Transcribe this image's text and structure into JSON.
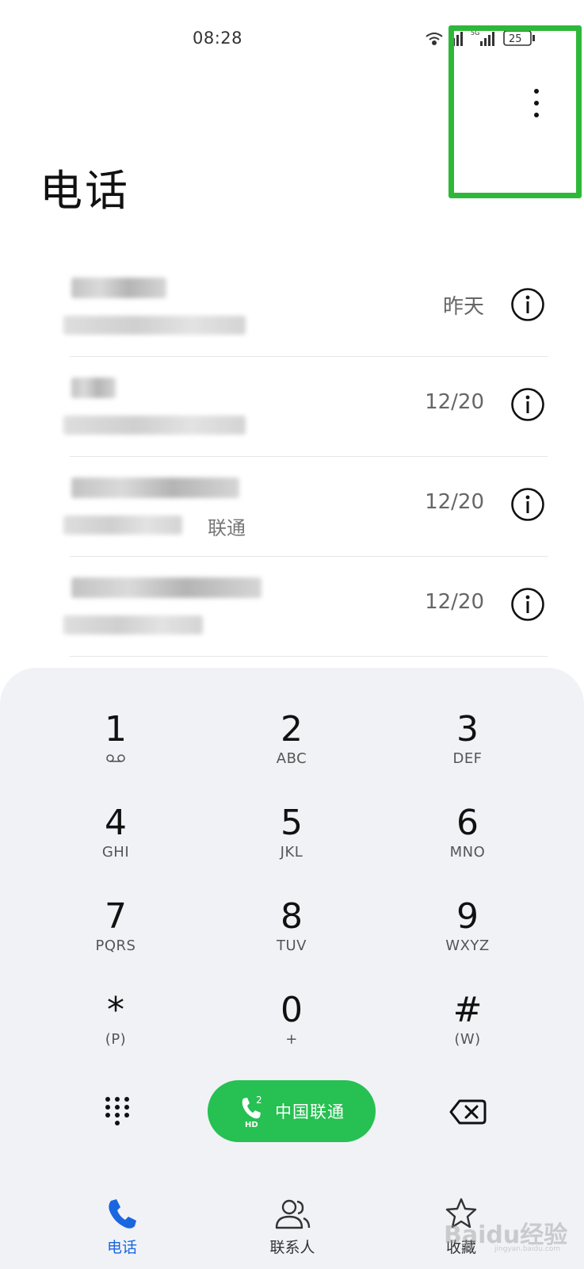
{
  "status_bar": {
    "time": "08:28",
    "battery": "25",
    "network": "5G"
  },
  "header": {
    "title": "电话"
  },
  "call_log": [
    {
      "date": "昨天",
      "sub_suffix": ""
    },
    {
      "date": "12/20",
      "sub_suffix": ""
    },
    {
      "date": "12/20",
      "sub_suffix": "联通"
    },
    {
      "date": "12/20",
      "sub_suffix": ""
    }
  ],
  "dialpad": {
    "keys": [
      {
        "digit": "1",
        "letters": ""
      },
      {
        "digit": "2",
        "letters": "ABC"
      },
      {
        "digit": "3",
        "letters": "DEF"
      },
      {
        "digit": "4",
        "letters": "GHI"
      },
      {
        "digit": "5",
        "letters": "JKL"
      },
      {
        "digit": "6",
        "letters": "MNO"
      },
      {
        "digit": "7",
        "letters": "PQRS"
      },
      {
        "digit": "8",
        "letters": "TUV"
      },
      {
        "digit": "9",
        "letters": "WXYZ"
      },
      {
        "digit": "*",
        "letters": "(P)"
      },
      {
        "digit": "0",
        "letters": "+"
      },
      {
        "digit": "#",
        "letters": "(W)"
      }
    ],
    "call_button_label": "中国联通",
    "sim_slot": "2",
    "hd_badge": "HD"
  },
  "bottom_nav": {
    "items": [
      {
        "label": "电话",
        "icon": "phone-icon",
        "active": true
      },
      {
        "label": "联系人",
        "icon": "contacts-icon",
        "active": false
      },
      {
        "label": "收藏",
        "icon": "star-icon",
        "active": false
      }
    ]
  },
  "watermark": {
    "text": "Baidu经验",
    "url": "jingyan.baidu.com"
  },
  "colors": {
    "accent_green": "#27c052",
    "highlight_green": "#2eb83a",
    "active_blue": "#1a66e0",
    "dialer_bg": "#f1f2f6"
  }
}
